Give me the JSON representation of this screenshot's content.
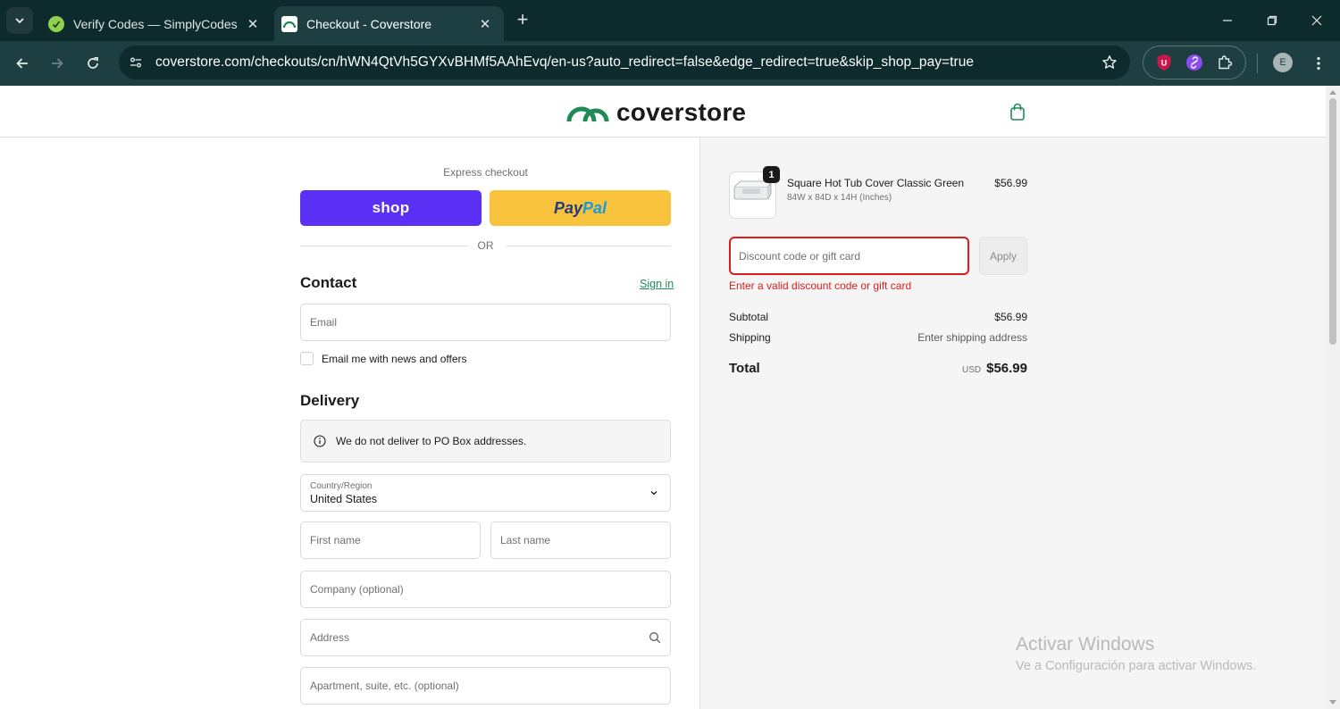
{
  "browser": {
    "tabs": [
      {
        "title": "Verify Codes — SimplyCodes",
        "active": false
      },
      {
        "title": "Checkout - Coverstore",
        "active": true
      }
    ],
    "url": "coverstore.com/checkouts/cn/hWN4QtVh5GYXvBHMf5AAhEvq/en-us?auto_redirect=false&edge_redirect=true&skip_shop_pay=true",
    "profile_initial": "E",
    "colors": {
      "frame": "#0d2a2d",
      "toolbar": "#1e3f42"
    }
  },
  "store": {
    "brand": "coverstore",
    "brand_color": "#1f8a55"
  },
  "checkout": {
    "express_label": "Express checkout",
    "shop_label": "shop",
    "paypal_pay": "Pay",
    "paypal_pal": "Pal",
    "or_label": "OR",
    "contact_title": "Contact",
    "signin_label": "Sign in",
    "email_placeholder": "Email",
    "newsletter_label": "Email me with news and offers",
    "delivery_title": "Delivery",
    "po_box_notice": "We do not deliver to PO Box addresses.",
    "country_label": "Country/Region",
    "country_value": "United States",
    "first_name_placeholder": "First name",
    "last_name_placeholder": "Last name",
    "company_placeholder": "Company (optional)",
    "address_placeholder": "Address",
    "apartment_placeholder": "Apartment, suite, etc. (optional)",
    "colors": {
      "shop": "#5a31f4",
      "paypal": "#f9c23c",
      "error": "#dd1d1d"
    }
  },
  "summary": {
    "item": {
      "quantity": "1",
      "name": "Square Hot Tub Cover Classic Green",
      "variant": "84W x 84D x 14H (Inches)",
      "price": "$56.99"
    },
    "discount_placeholder": "Discount code or gift card",
    "apply_label": "Apply",
    "discount_error": "Enter a valid discount code or gift card",
    "subtotal_label": "Subtotal",
    "subtotal_value": "$56.99",
    "shipping_label": "Shipping",
    "shipping_value": "Enter shipping address",
    "total_label": "Total",
    "total_currency": "USD",
    "total_value": "$56.99"
  },
  "watermark": {
    "title": "Activar Windows",
    "subtitle": "Ve a Configuración para activar Windows."
  }
}
